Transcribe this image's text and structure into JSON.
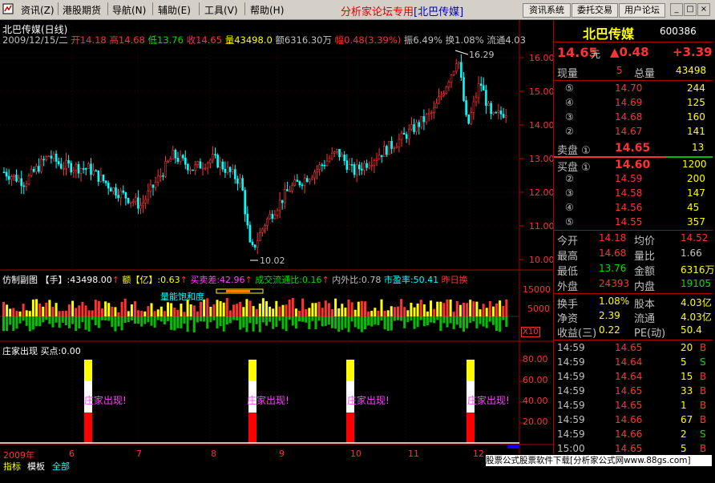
{
  "menu": {
    "items": [
      "资讯(Z)",
      "港股期货",
      "导航(N)",
      "辅助(E)",
      "工具(V)",
      "帮助(H)"
    ],
    "title": "分析家论坛专用",
    "stock_tag": "[北巴传媒]",
    "buttons": [
      "资讯系统",
      "委托交易",
      "用户论坛"
    ],
    "win": [
      "_",
      "□",
      "×"
    ]
  },
  "main_chart": {
    "title": "北巴传媒(日线)",
    "info": {
      "date": "2009/12/15/二",
      "open": "开14.18",
      "high": "高14.68",
      "low": "低13.76",
      "close": "收14.65",
      "volume": "量43498.0",
      "amount": "额6316.30万",
      "change": "幅0.48(3.39%)",
      "amplitude": "振6.49%",
      "turnover": "换1.08%",
      "float": "流通4.03"
    },
    "high_mark": "16.29",
    "low_mark": "10.02",
    "price_axis": [
      "16.00",
      "15.00",
      "14.00",
      "13.00",
      "12.00",
      "11.00",
      "10.00"
    ]
  },
  "sub1": {
    "label": "仿制副图",
    "vol": "【手】:43498.00",
    "amt": "额【亿】:0.63",
    "diff": "买卖差:42.96",
    "circ": "成交流通比:0.16",
    "inout": "内外比:0.78",
    "pe": "市盈率:50.41",
    "prev": "昨日换",
    "overlay": "量能饱和度",
    "axis": [
      "15000",
      "5000"
    ],
    "x10": "X10"
  },
  "sub2": {
    "label": "庄家出现",
    "buy": "买点:0.00",
    "signal": "庄家出现!",
    "axis": [
      "80.00",
      "60.00",
      "40.00",
      "20.00"
    ]
  },
  "xaxis": {
    "labels": [
      "2009年",
      "6",
      "7",
      "8",
      "9",
      "10",
      "11",
      "12"
    ]
  },
  "bottom_tabs": [
    "指标",
    "模板",
    "全部"
  ],
  "right": {
    "name": "北巴传媒",
    "code": "600386",
    "price": "14.65",
    "unit": "元",
    "change": "▲0.48",
    "change2": "+3.39",
    "xianliang_label": "现量",
    "xianliang": "5",
    "zongliang_label": "总量",
    "zongliang": "43498",
    "sell": [
      {
        "label": "⑤",
        "price": "14.70",
        "vol": "244"
      },
      {
        "label": "④",
        "price": "14.69",
        "vol": "125"
      },
      {
        "label": "③",
        "price": "14.68",
        "vol": "160"
      },
      {
        "label": "②",
        "price": "14.67",
        "vol": "141"
      }
    ],
    "sell1": {
      "label": "卖盘 ①",
      "price": "14.65",
      "vol": "13"
    },
    "buy1": {
      "label": "买盘 ①",
      "price": "14.60",
      "vol": "1200"
    },
    "buy": [
      {
        "label": "②",
        "price": "14.59",
        "vol": "200"
      },
      {
        "label": "③",
        "price": "14.58",
        "vol": "147"
      },
      {
        "label": "④",
        "price": "14.56",
        "vol": "45"
      },
      {
        "label": "⑤",
        "price": "14.55",
        "vol": "357"
      }
    ],
    "stats": [
      {
        "l1": "今开",
        "v1": "14.18",
        "l2": "均价",
        "v2": "14.52"
      },
      {
        "l1": "最高",
        "v1": "14.68",
        "l2": "量比",
        "v2": "1.66"
      },
      {
        "l1": "最低",
        "v1": "13.76",
        "l2": "金额",
        "v2": "6316万"
      },
      {
        "l1": "外盘",
        "v1": "24393",
        "l2": "内盘",
        "v2": "19105"
      }
    ],
    "stats2": [
      {
        "l1": "换手",
        "v1": "1.08%",
        "l2": "股本",
        "v2": "4.03亿"
      },
      {
        "l1": "净资",
        "v1": "2.39",
        "l2": "流通",
        "v2": "4.03亿"
      },
      {
        "l1": "收益(三)",
        "v1": "0.22",
        "l2": "PE(动)",
        "v2": "50.4"
      }
    ],
    "ticks": [
      {
        "t": "14:59",
        "p": "14.65",
        "v": "20",
        "s": "B"
      },
      {
        "t": "14:59",
        "p": "14.64",
        "v": "5",
        "s": "S"
      },
      {
        "t": "14:59",
        "p": "14.64",
        "v": "15",
        "s": "B"
      },
      {
        "t": "14:59",
        "p": "14.65",
        "v": "33",
        "s": "B"
      },
      {
        "t": "14:59",
        "p": "14.65",
        "v": "1",
        "s": "B"
      },
      {
        "t": "14:59",
        "p": "14.66",
        "v": "67",
        "s": "B"
      },
      {
        "t": "14:59",
        "p": "14.66",
        "v": "2",
        "s": "S"
      },
      {
        "t": "15:00",
        "p": "14.65",
        "v": "5",
        "s": "B"
      }
    ]
  },
  "footer": "股票公式股票软件下载[分析家公式网www.88gs.com]",
  "colors": {
    "up": "#ff3232",
    "down": "#00ffff",
    "yellow": "#ffff00",
    "green": "#00c000"
  }
}
